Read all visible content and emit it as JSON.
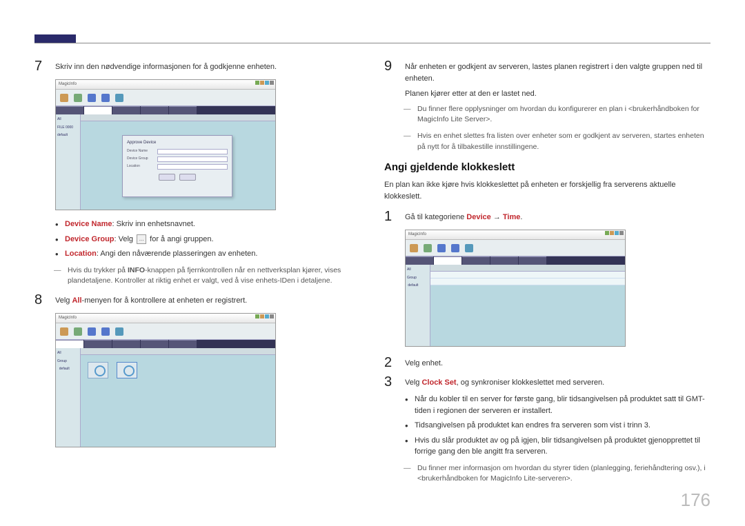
{
  "page_number": "176",
  "left": {
    "step7": {
      "num": "7",
      "text": "Skriv inn den nødvendige informasjonen for å godkjenne enheten."
    },
    "screenshot1": {
      "logo": "MagicInfo",
      "dialog_title": "Approve Device",
      "field1": "Device Name",
      "field2": "Device Group",
      "field3": "Location",
      "ok": "OK",
      "cancel": "Cancel"
    },
    "bullets7": {
      "b1_label": "Device Name",
      "b1_text": ": Skriv inn enhetsnavnet.",
      "b2_label": "Device Group",
      "b2_text_a": ": Velg ",
      "b2_text_b": " for å angi gruppen.",
      "b2_icon": "...",
      "b3_label": "Location",
      "b3_text": ": Angi den nåværende plasseringen av enheten."
    },
    "dash7": "Hvis du trykker på INFO-knappen på fjernkontrollen når en nettverksplan kjører, vises plandetaljene. Kontroller at riktig enhet er valgt, ved å vise enhets-IDen i detaljene.",
    "dash7_info": "INFO",
    "step8": {
      "num": "8",
      "text_a": "Velg ",
      "red": "All",
      "text_b": "-menyen for å kontrollere at enheten er registrert."
    },
    "screenshot2": {
      "logo": "MagicInfo"
    }
  },
  "right": {
    "step9": {
      "num": "9",
      "line1": "Når enheten er godkjent av serveren, lastes planen registrert i den valgte gruppen ned til enheten.",
      "line2": "Planen kjører etter at den er lastet ned."
    },
    "dash9a": "Du finner flere opplysninger om hvordan du konfigurerer en plan i <brukerhåndboken for MagicInfo Lite Server>.",
    "dash9b": "Hvis en enhet slettes fra listen over enheter som er godkjent av serveren, startes enheten på nytt for å tilbakestille innstillingene.",
    "section_title": "Angi gjeldende klokkeslett",
    "intro": "En plan kan ikke kjøre hvis klokkeslettet på enheten er forskjellig fra serverens aktuelle klokkeslett.",
    "step1": {
      "num": "1",
      "text_a": "Gå til kategoriene ",
      "red1": "Device",
      "arrow": " → ",
      "red2": "Time",
      "text_b": "."
    },
    "screenshot3": {
      "logo": "MagicInfo"
    },
    "step2": {
      "num": "2",
      "text": "Velg enhet."
    },
    "step3": {
      "num": "3",
      "text_a": "Velg ",
      "red": "Clock Set",
      "text_b": ", og synkroniser klokkeslettet med serveren."
    },
    "bullets_end": {
      "b1": "Når du kobler til en server for første gang, blir tidsangivelsen på produktet satt til GMT-tiden i regionen der serveren er installert.",
      "b2": "Tidsangivelsen på produktet kan endres fra serveren som vist i trinn 3.",
      "b3": "Hvis du slår produktet av og på igjen, blir tidsangivelsen på produktet gjenopprettet til forrige gang den ble angitt fra serveren."
    },
    "dash_end": "Du finner mer informasjon om hvordan du styrer tiden (planlegging, feriehåndtering osv.), i <brukerhåndboken for MagicInfo Lite-serveren>."
  }
}
